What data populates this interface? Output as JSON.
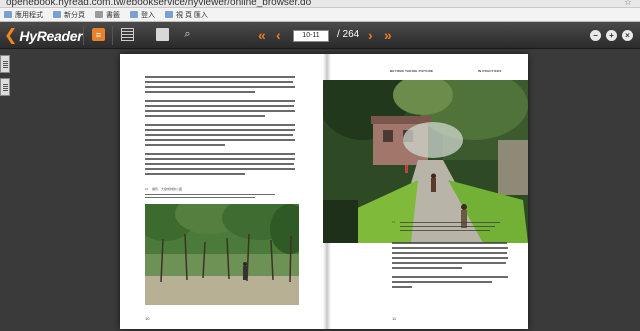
{
  "browser": {
    "url": "openebook.hyread.com.tw/ebookservice/hyviewer/online_browser.do",
    "bookmarks": [
      {
        "label": "應用程式",
        "icon": "apps-icon"
      },
      {
        "label": "新分頁",
        "icon": "page-icon"
      },
      {
        "label": "書籤",
        "icon": "folder-icon"
      },
      {
        "label": "登入",
        "icon": "page-icon"
      },
      {
        "label": "視 頁 匯入",
        "icon": "page-icon"
      }
    ]
  },
  "toolbar": {
    "logo_mark": "❮",
    "logo_text": "HyReader",
    "page_current": "10-11",
    "page_total": "/ 264",
    "first_label": "«",
    "prev_label": "‹",
    "next_label": "›",
    "last_label": "»",
    "zoom_out": "−",
    "zoom_in": "+",
    "close": "×",
    "accent_color": "#f07a1e"
  },
  "book": {
    "right_header_left": "BEYOND TAKING PICTURE",
    "right_header_right": "IN PRACTICES",
    "left_caption_num": "10",
    "left_caption": "攝影：大樹成林的公園",
    "right_caption_num": "11",
    "left_page_number": "10",
    "right_page_number": "11"
  }
}
